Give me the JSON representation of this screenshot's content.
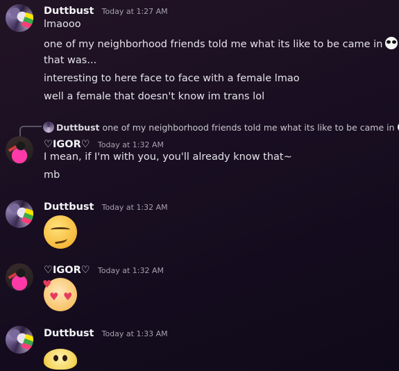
{
  "users": {
    "duttbust": "Duttbust",
    "igor": "♡IGOR♡"
  },
  "messages": [
    {
      "author": "Duttbust",
      "timestamp": "Today at 1:27 AM",
      "lines": [
        "lmaooo",
        "one of my neighborhood friends told me what its like to be came in",
        "that was...",
        "interesting to here face to face with a female lmao",
        "well a female that doesn't know im trans lol"
      ]
    },
    {
      "reply": {
        "author": "Duttbust",
        "text": "one of my neighborhood friends told me what its like to be came in"
      },
      "author": "♡IGOR♡",
      "timestamp": "Today at 1:32 AM",
      "lines": [
        "I mean, if I'm with you, you'll already know that~",
        "mb"
      ]
    },
    {
      "author": "Duttbust",
      "timestamp": "Today at 1:32 AM",
      "emoji": "smirk-emoji"
    },
    {
      "author": "♡IGOR♡",
      "timestamp": "Today at 1:32 AM",
      "emoji": "heart-eyes-emoji"
    },
    {
      "author": "Duttbust",
      "timestamp": "Today at 1:33 AM",
      "emoji": "melting-blob-emoji"
    }
  ],
  "colors": {
    "background_top": "#221425",
    "background_bottom": "#0f0a19",
    "author": "#f2f3f5",
    "timestamp": "#a5a2ad",
    "text": "#e4e3ea"
  }
}
